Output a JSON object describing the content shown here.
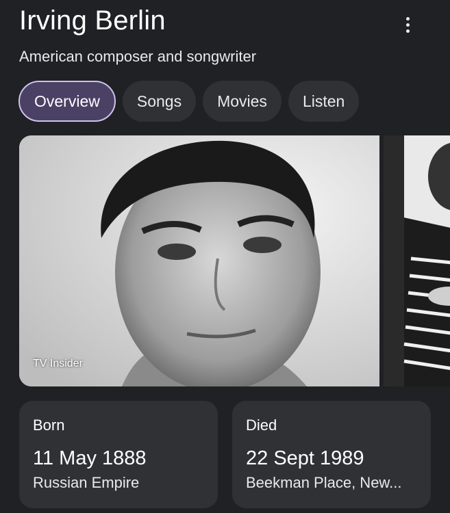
{
  "header": {
    "title": "Irving Berlin",
    "subtitle": "American composer and songwriter",
    "menu_icon": "more-vert-icon"
  },
  "tabs": [
    {
      "label": "Overview",
      "active": true
    },
    {
      "label": "Songs",
      "active": false
    },
    {
      "label": "Movies",
      "active": false
    },
    {
      "label": "Listen",
      "active": false
    }
  ],
  "gallery": {
    "main_caption": "TV Insider"
  },
  "facts": {
    "born": {
      "label": "Born",
      "date": "11 May 1888",
      "place": "Russian Empire"
    },
    "died": {
      "label": "Died",
      "date": "22 Sept 1989",
      "place": "Beekman Place, New..."
    }
  },
  "colors": {
    "background": "#202124",
    "card": "#303134",
    "active_tab": "#4a4165",
    "active_tab_border": "#cfc3ee"
  }
}
